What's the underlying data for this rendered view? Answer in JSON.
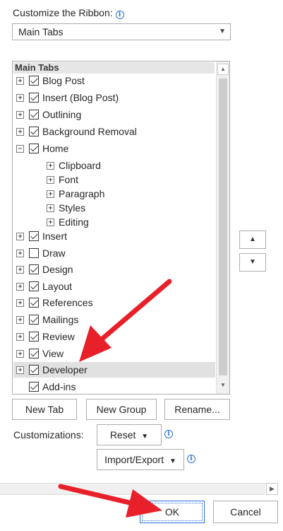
{
  "customize": {
    "label": "Customize the Ribbon:",
    "dropdown_value": "Main Tabs"
  },
  "tree": {
    "header": "Main Tabs",
    "items": [
      {
        "label": "Blog Post",
        "checked": true,
        "expander": "+"
      },
      {
        "label": "Insert (Blog Post)",
        "checked": true,
        "expander": "+"
      },
      {
        "label": "Outlining",
        "checked": true,
        "expander": "+"
      },
      {
        "label": "Background Removal",
        "checked": true,
        "expander": "+"
      },
      {
        "label": "Home",
        "checked": true,
        "expander": "−"
      },
      {
        "label": "Clipboard",
        "expander": "+"
      },
      {
        "label": "Font",
        "expander": "+"
      },
      {
        "label": "Paragraph",
        "expander": "+"
      },
      {
        "label": "Styles",
        "expander": "+"
      },
      {
        "label": "Editing",
        "expander": "+"
      },
      {
        "label": "Insert",
        "checked": true,
        "expander": "+"
      },
      {
        "label": "Draw",
        "checked": false,
        "expander": "+"
      },
      {
        "label": "Design",
        "checked": true,
        "expander": "+"
      },
      {
        "label": "Layout",
        "checked": true,
        "expander": "+"
      },
      {
        "label": "References",
        "checked": true,
        "expander": "+"
      },
      {
        "label": "Mailings",
        "checked": true,
        "expander": "+"
      },
      {
        "label": "Review",
        "checked": true,
        "expander": "+"
      },
      {
        "label": "View",
        "checked": true,
        "expander": "+"
      },
      {
        "label": "Developer",
        "checked": true,
        "expander": "+"
      },
      {
        "label": "Add-ins",
        "checked": true
      }
    ]
  },
  "buttons": {
    "new_tab": "New Tab",
    "new_group": "New Group",
    "rename": "Rename...",
    "customizations_label": "Customizations:",
    "reset": "Reset",
    "import_export": "Import/Export",
    "ok": "OK",
    "cancel": "Cancel"
  },
  "icons": {
    "dropdown_arrow": "▼",
    "scroll_up": "▲",
    "scroll_down": "▼",
    "scroll_right": "▶",
    "move_up": "▲",
    "move_down": "▼",
    "info": "i"
  },
  "colors": {
    "annotation_arrow": "#e8202a",
    "selection": "#e1e1e1",
    "default_button_border": "#2b6fd6"
  }
}
